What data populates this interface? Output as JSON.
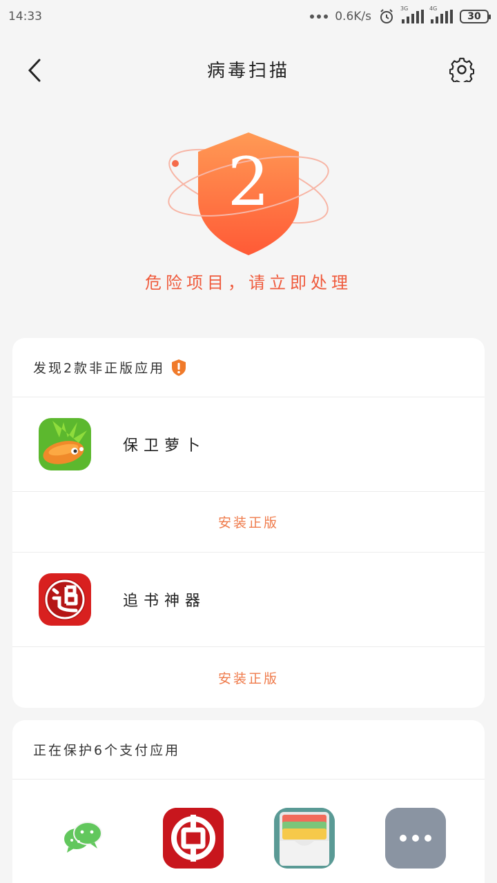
{
  "status_bar": {
    "time": "14:33",
    "speed": "0.6K/s",
    "net1_tag": "3G",
    "net2_tag": "4G",
    "battery": "30"
  },
  "header": {
    "title": "病毒扫描"
  },
  "hero": {
    "count": "2",
    "message": "危险项目，请立即处理",
    "accent": "#ff6a3d"
  },
  "pirated_section": {
    "title": "发现2款非正版应用",
    "apps": [
      {
        "name": "保卫萝卜",
        "action": "安装正版",
        "icon": "carrot-app-icon"
      },
      {
        "name": "追书神器",
        "action": "安装正版",
        "icon": "zhuishu-app-icon"
      }
    ]
  },
  "payment_section": {
    "title": "正在保护6个支付应用",
    "icons": [
      "wechat-icon",
      "bank-of-china-icon",
      "wallet-icon",
      "more-apps-icon"
    ]
  }
}
